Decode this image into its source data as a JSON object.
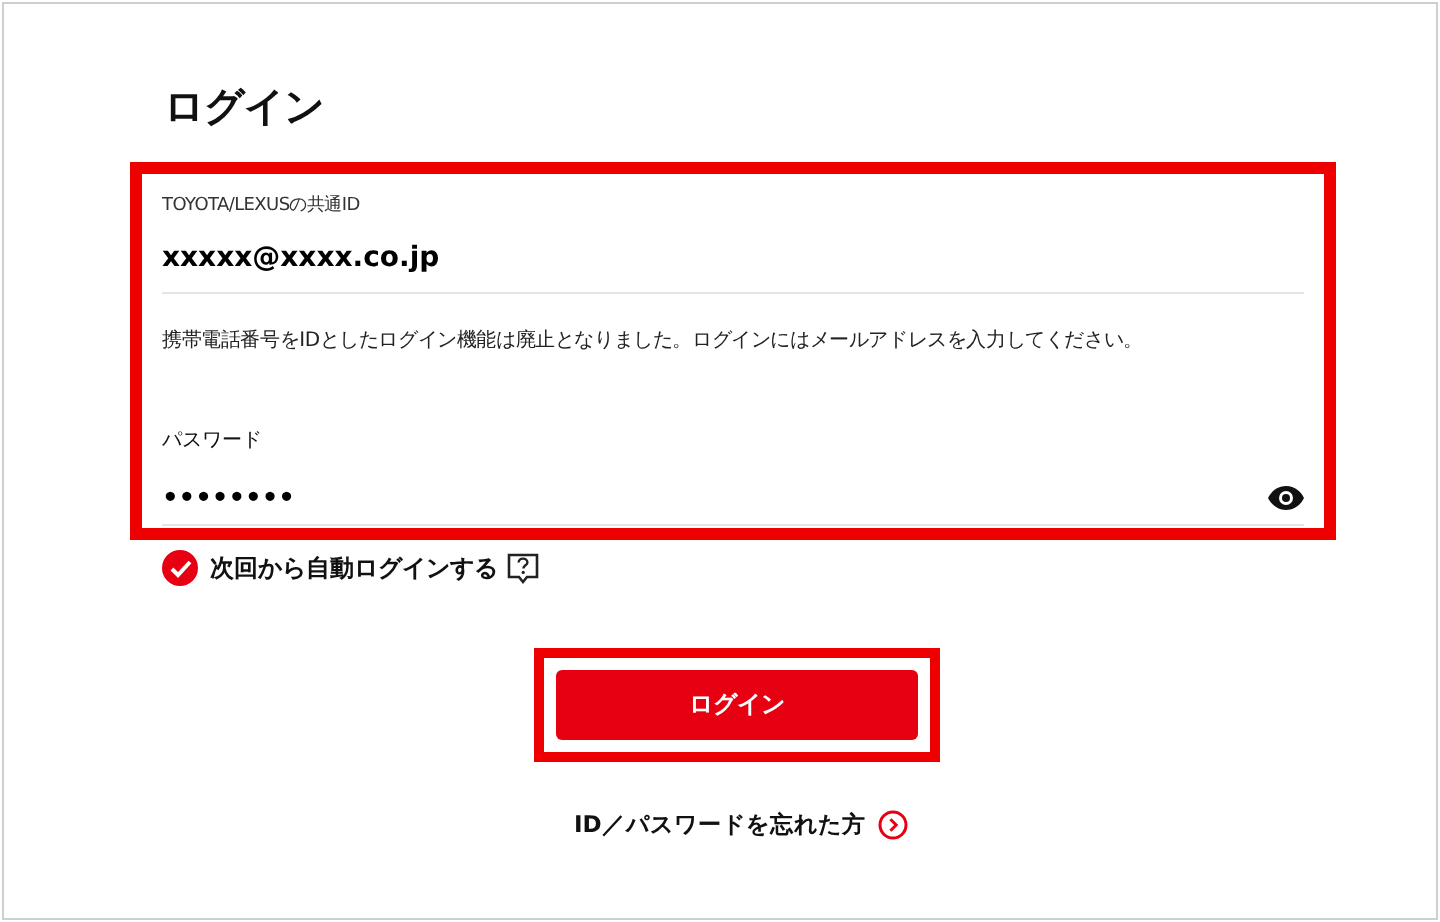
{
  "title": "ログイン",
  "id_field": {
    "label": "TOYOTA/LEXUSの共通ID",
    "value": "xxxxx@xxxx.co.jp"
  },
  "notice": "携帯電話番号をIDとしたログイン機能は廃止となりました。ログインにはメールアドレスを入力してください。",
  "password_field": {
    "label": "パスワード",
    "value": "••••••••"
  },
  "auto_login": {
    "label": "次回から自動ログインする",
    "checked": true
  },
  "login_button": "ログイン",
  "forgot_link": "ID／パスワードを忘れた方"
}
